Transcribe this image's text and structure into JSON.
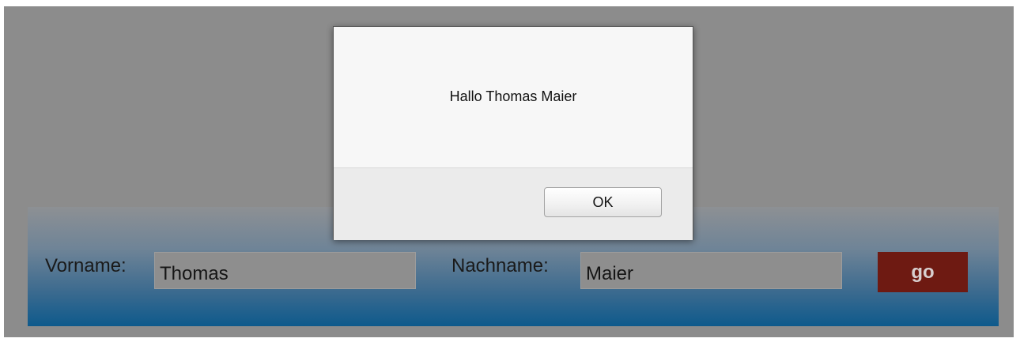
{
  "form": {
    "first_name_label": "Vorname:",
    "first_name_value": "Thomas",
    "last_name_label": "Nachname:",
    "last_name_value": "Maier",
    "submit_label": "go"
  },
  "alert": {
    "message": "Hallo Thomas Maier",
    "ok_label": "OK"
  },
  "colors": {
    "page_background": "#8c8c8c",
    "panel_gradient_bottom": "#0e5a8c",
    "go_button": "#6e1a12"
  }
}
